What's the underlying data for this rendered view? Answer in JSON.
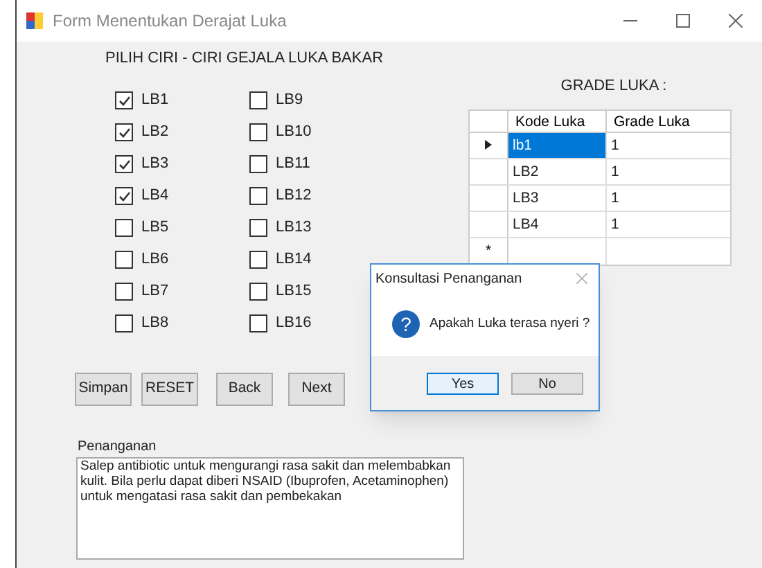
{
  "window": {
    "title": "Form Menentukan Derajat Luka"
  },
  "heading": "PILIH CIRI - CIRI GEJALA LUKA BAKAR",
  "checkboxes": [
    {
      "label": "LB1",
      "checked": true
    },
    {
      "label": "LB2",
      "checked": true
    },
    {
      "label": "LB3",
      "checked": true
    },
    {
      "label": "LB4",
      "checked": true
    },
    {
      "label": "LB5",
      "checked": false
    },
    {
      "label": "LB6",
      "checked": false
    },
    {
      "label": "LB7",
      "checked": false
    },
    {
      "label": "LB8",
      "checked": false
    },
    {
      "label": "LB9",
      "checked": false
    },
    {
      "label": "LB10",
      "checked": false
    },
    {
      "label": "LB11",
      "checked": false
    },
    {
      "label": "LB12",
      "checked": false
    },
    {
      "label": "LB13",
      "checked": false
    },
    {
      "label": "LB14",
      "checked": false
    },
    {
      "label": "LB15",
      "checked": false
    },
    {
      "label": "LB16",
      "checked": false
    }
  ],
  "grade_label": "GRADE LUKA :",
  "table": {
    "columns": [
      "Kode Luka",
      "Grade Luka"
    ],
    "rows": [
      {
        "cells": [
          "lb1",
          "1"
        ],
        "selected": true
      },
      {
        "cells": [
          "LB2",
          "1"
        ],
        "selected": false
      },
      {
        "cells": [
          "LB3",
          "1"
        ],
        "selected": false
      },
      {
        "cells": [
          "LB4",
          "1"
        ],
        "selected": false
      }
    ],
    "new_row_marker": "*"
  },
  "buttons": [
    "Simpan",
    "RESET",
    "Back",
    "Next"
  ],
  "penanganan": {
    "label": "Penanganan",
    "text": "Salep antibiotic untuk mengurangi rasa sakit dan melembabkan kulit. Bila perlu dapat diberi NSAID (Ibuprofen, Acetaminophen) untuk mengatasi rasa sakit dan pembekakan"
  },
  "dialog": {
    "title": "Konsultasi Penanganan",
    "message": "Apakah Luka terasa nyeri ?",
    "icon_glyph": "?",
    "buttons": [
      {
        "label": "Yes",
        "selected": true
      },
      {
        "label": "No",
        "selected": false
      }
    ]
  }
}
